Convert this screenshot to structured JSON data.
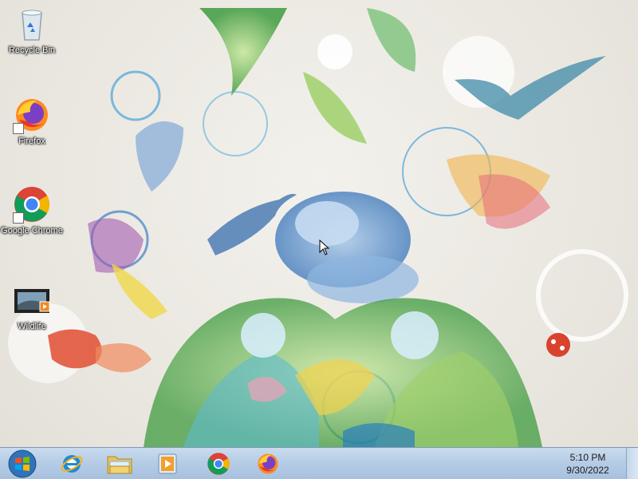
{
  "desktop_icons": [
    {
      "label": "Recycle Bin",
      "icon": "recycle-bin-icon"
    },
    {
      "label": "Firefox",
      "icon": "firefox-icon"
    },
    {
      "label": "Google Chrome",
      "icon": "chrome-icon"
    },
    {
      "label": "Wildlife",
      "icon": "video-file-icon"
    }
  ],
  "taskbar": {
    "start_icon": "windows-start-icon",
    "pinned": [
      "internet-explorer-icon",
      "file-explorer-icon",
      "media-player-icon",
      "chrome-icon",
      "firefox-icon"
    ],
    "clock": {
      "time": "5:10 PM",
      "date": "9/30/2022"
    }
  },
  "colors": {
    "taskbar": "#b7cde6",
    "desktop_bg": "#ebe8e2"
  }
}
